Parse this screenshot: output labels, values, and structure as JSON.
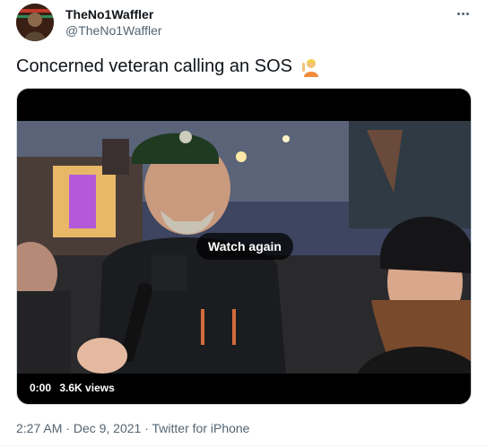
{
  "author": {
    "display_name": "TheNo1Waffler",
    "handle": "@TheNo1Waffler"
  },
  "tweet": {
    "text": "Concerned veteran calling an SOS",
    "emoji": "person-raising-hand"
  },
  "media": {
    "overlay_button": "Watch again",
    "time": "0:00",
    "views": "3.6K views"
  },
  "meta": {
    "time": "2:27 AM",
    "separator": " · ",
    "date": "Dec 9, 2021",
    "source": "Twitter for iPhone"
  },
  "icons": [
    "more-icon",
    "raising-hand-emoji-icon"
  ],
  "colors": {
    "text_primary": "#0f1419",
    "text_secondary": "#536471",
    "border": "#cfd9de"
  }
}
